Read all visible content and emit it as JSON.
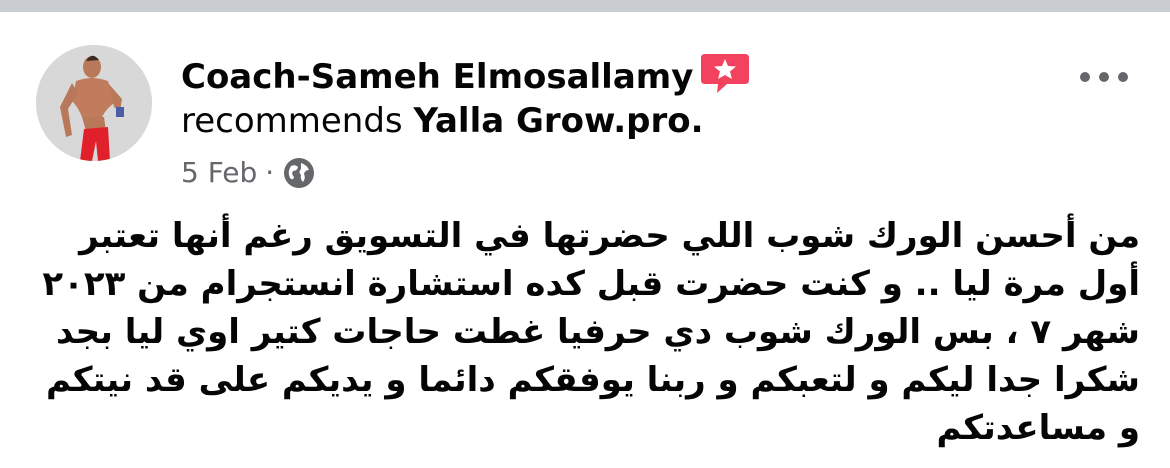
{
  "post": {
    "author": "Coach-Sameh Elmosallamy",
    "action": "recommends",
    "page": "Yalla Grow.pro.",
    "date": "5 Feb",
    "separator": "·",
    "privacy_icon": "globe-icon",
    "recommend_icon": "star-flag-icon",
    "more_icon": "more-options-icon",
    "text": "من أحسن الورك شوب اللي حضرتها في التسويق رغم أنها تعتبر أول مرة ليا .. و كنت حضرت قبل كده استشارة انستجرام من ٢٠٢٣ شهر ٧ ، بس الورك شوب دي حرفيا غطت حاجات كتير اوي ليا بجد شكرا جدا ليكم و لتعبكم و ربنا يوفقكم دائما و يديكم على قد نيتكم و مساعدتكم"
  },
  "colors": {
    "text": "#050505",
    "meta": "#65676b",
    "accent": "#f3425f"
  }
}
